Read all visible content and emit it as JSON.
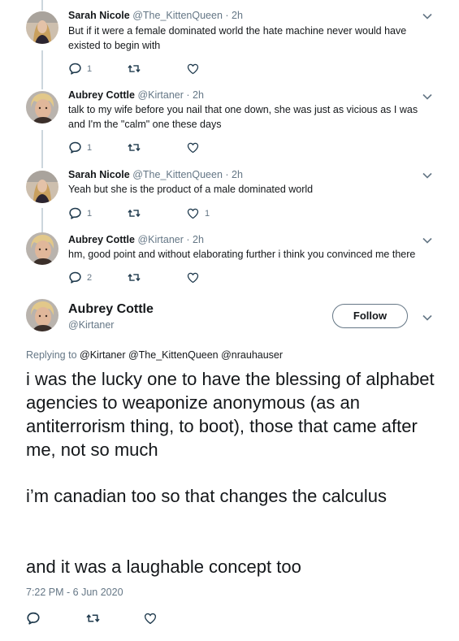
{
  "thread": [
    {
      "name": "Sarah Nicole",
      "handle": "@The_KittenQueen",
      "dot": "·",
      "time": "2h",
      "text": "But if it were a female dominated world the hate machine never would have existed to begin with",
      "reply_count": "1",
      "retweet_count": "",
      "like_count": "",
      "avatar": "avatar-sarah"
    },
    {
      "name": "Aubrey Cottle",
      "handle": "@Kirtaner",
      "dot": "·",
      "time": "2h",
      "text": "talk to my wife before you nail that one down, she was just as vicious as I was and I'm the \"calm\" one these days",
      "reply_count": "1",
      "retweet_count": "",
      "like_count": "",
      "avatar": "avatar-aubrey"
    },
    {
      "name": "Sarah Nicole",
      "handle": "@The_KittenQueen",
      "dot": "·",
      "time": "2h",
      "text": "Yeah but she is the product of a male dominated world",
      "reply_count": "1",
      "retweet_count": "",
      "like_count": "1",
      "avatar": "avatar-sarah"
    },
    {
      "name": "Aubrey Cottle",
      "handle": "@Kirtaner",
      "dot": "·",
      "time": "2h",
      "text": "hm, good point and without elaborating further i think you convinced me there",
      "reply_count": "2",
      "retweet_count": "",
      "like_count": "",
      "avatar": "avatar-aubrey"
    }
  ],
  "main": {
    "name": "Aubrey Cottle",
    "handle": "@Kirtaner",
    "follow_label": "Follow",
    "replying_prefix": "Replying to",
    "replying_mentions": "@Kirtaner @The_KittenQueen @nrauhauser",
    "paragraph1": "i was the lucky one to have the blessing of alphabet agencies to weaponize anonymous (as an antiterrorism thing, to boot), those that came after me, not so much",
    "paragraph2": "i’m canadian too so that changes the calculus",
    "paragraph3": "and it was a laughable concept too",
    "timestamp": "7:22 PM - 6 Jun 2020"
  },
  "colors": {
    "text": "#14171a",
    "secondary": "#657786",
    "thread_line": "#ccd6dd"
  },
  "icons": [
    "reply-icon",
    "retweet-icon",
    "like-icon",
    "chevron-down-icon"
  ]
}
